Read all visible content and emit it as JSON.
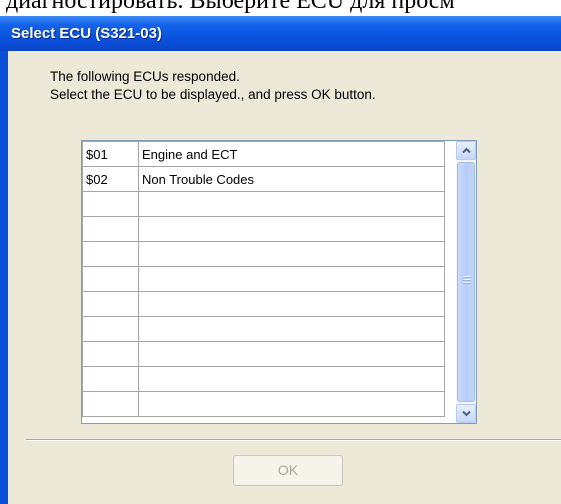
{
  "background_heading": "диагностировать. Выберите ЕСU для просм",
  "window": {
    "title": "Select ECU (S321-03)",
    "titlebar_color": "#0a55e0",
    "client_color": "#ece9d8"
  },
  "instructions": {
    "line1": "The following ECUs responded.",
    "line2": "Select the ECU to be displayed., and press OK button."
  },
  "ecu_list": {
    "rows": [
      {
        "id": "$01",
        "name": "Engine and ECT"
      },
      {
        "id": "$02",
        "name": "Non Trouble Codes"
      },
      {
        "id": "",
        "name": ""
      },
      {
        "id": "",
        "name": ""
      },
      {
        "id": "",
        "name": ""
      },
      {
        "id": "",
        "name": ""
      },
      {
        "id": "",
        "name": ""
      },
      {
        "id": "",
        "name": ""
      },
      {
        "id": "",
        "name": ""
      },
      {
        "id": "",
        "name": ""
      },
      {
        "id": "",
        "name": ""
      }
    ],
    "scrollbar": {
      "up_icon": "chevron-up-icon",
      "down_icon": "chevron-down-icon"
    }
  },
  "buttons": {
    "ok_label": "OK",
    "ok_enabled": false
  }
}
